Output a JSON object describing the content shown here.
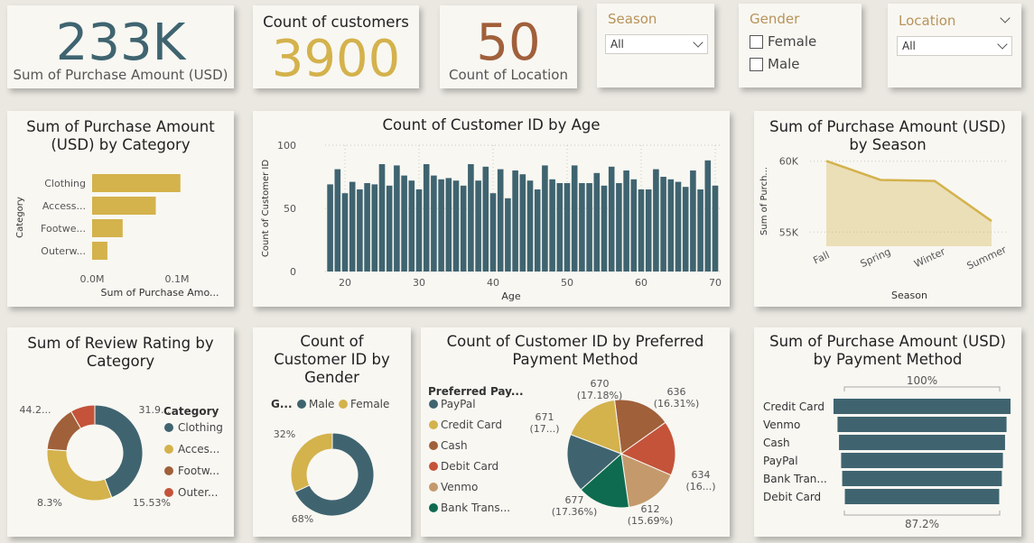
{
  "kpis": {
    "purchase": {
      "value": "233K",
      "label": "Sum of Purchase Amount (USD)"
    },
    "customers": {
      "title": "Count of customers",
      "value": "3900"
    },
    "location": {
      "value": "50",
      "label": "Count of Location"
    }
  },
  "slicers": {
    "season": {
      "title": "Season",
      "value": "All"
    },
    "gender": {
      "title": "Gender",
      "options": [
        "Female",
        "Male"
      ]
    },
    "location": {
      "title": "Location",
      "value": "All"
    }
  },
  "colors": {
    "teal": "#3f6470",
    "gold": "#d4b24c",
    "brown": "#a0603a",
    "red": "#c4533a",
    "tan": "#c49a6c",
    "green": "#0e6b50",
    "slicer_title": "#b8935a"
  },
  "chart_data": [
    {
      "id": "category",
      "type": "bar",
      "orientation": "horizontal",
      "title": "Sum of Purchase Amount (USD) by Category",
      "categories": [
        "Clothing",
        "Access...",
        "Footwe...",
        "Outerw..."
      ],
      "values": [
        0.104,
        0.075,
        0.036,
        0.018
      ],
      "xticks": [
        "0.0M",
        "0.1M"
      ],
      "xlim": [
        0,
        0.1
      ],
      "xlabel": "Sum of Purchase Amo...",
      "ylabel": "Category",
      "color": "#d4b24c"
    },
    {
      "id": "age",
      "type": "bar",
      "title": "Count of Customer ID by Age",
      "xlabel": "Age",
      "ylabel": "Count of Customer ID",
      "x": [
        18,
        19,
        20,
        21,
        22,
        23,
        24,
        25,
        26,
        27,
        28,
        29,
        30,
        31,
        32,
        33,
        34,
        35,
        36,
        37,
        38,
        39,
        40,
        41,
        42,
        43,
        44,
        45,
        46,
        47,
        48,
        49,
        50,
        51,
        52,
        53,
        54,
        55,
        56,
        57,
        58,
        59,
        60,
        61,
        62,
        63,
        64,
        65,
        66,
        67,
        68,
        69,
        70
      ],
      "values": [
        69,
        81,
        62,
        71,
        65,
        70,
        69,
        85,
        68,
        84,
        76,
        72,
        65,
        85,
        76,
        73,
        74,
        72,
        68,
        85,
        72,
        83,
        62,
        81,
        58,
        80,
        77,
        72,
        65,
        84,
        73,
        70,
        70,
        84,
        70,
        70,
        78,
        68,
        83,
        70,
        80,
        73,
        65,
        65,
        81,
        75,
        73,
        71,
        67,
        80,
        65,
        88,
        68
      ],
      "xticks": [
        20,
        30,
        40,
        50,
        60,
        70
      ],
      "yticks": [
        0,
        50,
        100
      ],
      "ylim": [
        0,
        100
      ],
      "color": "#3f6470"
    },
    {
      "id": "season",
      "type": "area",
      "title": "Sum of Purchase Amount (USD) by Season",
      "categories": [
        "Fall",
        "Spring",
        "Winter",
        "Summer"
      ],
      "values": [
        60018,
        58679,
        58607,
        55777
      ],
      "yticks": [
        "55K",
        "60K"
      ],
      "ylim": [
        54000,
        61000
      ],
      "xlabel": "Season",
      "ylabel": "Sum of Purch...",
      "color": "#d4b24c"
    },
    {
      "id": "review",
      "type": "pie",
      "variant": "donut",
      "title": "Sum of Review Rating by Category",
      "legend_title": "Category",
      "labels": [
        "Clothing",
        "Acces...",
        "Footw...",
        "Outer..."
      ],
      "values": [
        44.24,
        31.93,
        15.53,
        8.3
      ],
      "data_labels": [
        "44.2...",
        "31.9...",
        "15.53%",
        "8.3%"
      ],
      "colors": [
        "#3f6470",
        "#d4b24c",
        "#a0603a",
        "#c4533a"
      ]
    },
    {
      "id": "gender",
      "type": "pie",
      "variant": "donut",
      "title": "Count of Customer ID by Gender",
      "legend_title": "G...",
      "labels": [
        "Male",
        "Female"
      ],
      "values": [
        68,
        32
      ],
      "data_labels": [
        "68%",
        "32%"
      ],
      "colors": [
        "#3f6470",
        "#d4b24c"
      ]
    },
    {
      "id": "payment",
      "type": "pie",
      "title": "Count of Customer ID by Preferred Payment Method",
      "legend_title": "Preferred Pay...",
      "labels": [
        "PayPal",
        "Credit Card",
        "Cash",
        "Debit Card",
        "Venmo",
        "Bank Trans..."
      ],
      "values": [
        677,
        671,
        670,
        636,
        634,
        612
      ],
      "data_labels": [
        "677\n(17.36%)",
        "671\n(17...)",
        "670\n(17.18%)",
        "636\n(16.31%)",
        "634\n(16...)",
        "612\n(15.69%)"
      ],
      "colors": [
        "#3f6470",
        "#d4b24c",
        "#a0603a",
        "#c4533a",
        "#c49a6c",
        "#0e6b50"
      ]
    },
    {
      "id": "funnel",
      "type": "bar",
      "variant": "funnel",
      "title": "Sum of Purchase Amount (USD) by Payment Method",
      "categories": [
        "Credit Card",
        "Venmo",
        "Cash",
        "PayPal",
        "Bank Tran...",
        "Debit Card"
      ],
      "values": [
        100,
        95.5,
        93.8,
        91.4,
        90.2,
        87.2
      ],
      "top_label": "100%",
      "bottom_label": "87.2%",
      "color": "#3f6470"
    }
  ]
}
